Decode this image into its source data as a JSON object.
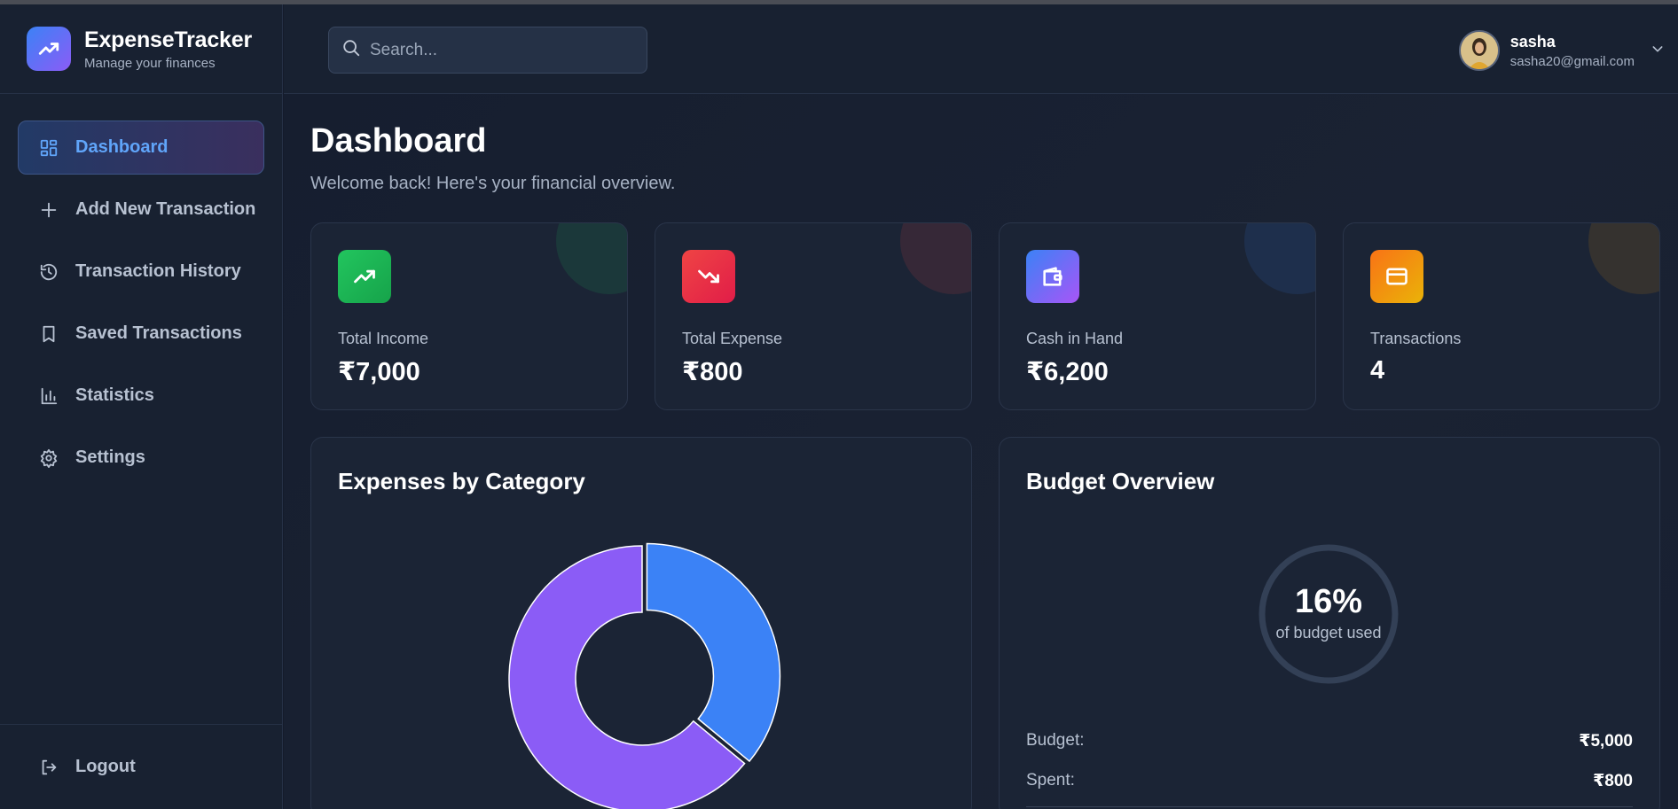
{
  "brand": {
    "title": "ExpenseTracker",
    "subtitle": "Manage your finances",
    "icon": "trending-up-icon"
  },
  "nav": {
    "items": [
      {
        "label": "Dashboard",
        "icon": "grid-icon",
        "active": true
      },
      {
        "label": "Add New Transaction",
        "icon": "plus-icon"
      },
      {
        "label": "Transaction History",
        "icon": "history-icon"
      },
      {
        "label": "Saved Transactions",
        "icon": "bookmark-icon"
      },
      {
        "label": "Statistics",
        "icon": "bar-chart-icon"
      },
      {
        "label": "Settings",
        "icon": "gear-icon"
      }
    ],
    "logout_label": "Logout"
  },
  "search": {
    "placeholder": "Search..."
  },
  "user": {
    "name": "sasha",
    "email": "sasha20@gmail.com"
  },
  "page": {
    "title": "Dashboard",
    "subtitle": "Welcome back! Here's your financial overview."
  },
  "stats": [
    {
      "label": "Total Income",
      "value": "₹7,000",
      "icon": "trending-up-icon",
      "color": "#22c55e"
    },
    {
      "label": "Total Expense",
      "value": "₹800",
      "icon": "trending-down-icon",
      "color": "#ef4444"
    },
    {
      "label": "Cash in Hand",
      "value": "₹6,200",
      "icon": "wallet-icon",
      "color": "#6366f1"
    },
    {
      "label": "Transactions",
      "value": "4",
      "icon": "credit-card-icon",
      "color": "#f59e0b"
    }
  ],
  "expenses": {
    "title": "Expenses by Category",
    "chart_data": {
      "type": "pie",
      "values": [
        0.36,
        0.64
      ],
      "colors": [
        "#3b82f6",
        "#8b5cf6"
      ]
    }
  },
  "budget": {
    "title": "Budget Overview",
    "percent": "16%",
    "percent_value": 16,
    "percent_label": "of budget used",
    "rows": [
      {
        "key": "Budget:",
        "value": "₹5,000"
      },
      {
        "key": "Spent:",
        "value": "₹800"
      }
    ]
  },
  "colors": {
    "accent": "#60a5fa",
    "background": "#141b2b",
    "card": "#1b2435"
  }
}
